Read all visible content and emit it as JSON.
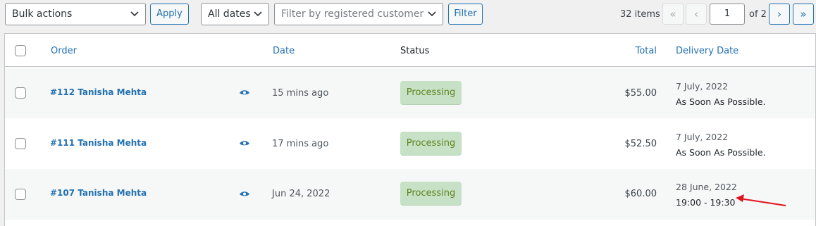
{
  "toolbar": {
    "bulk_actions": "Bulk actions",
    "apply": "Apply",
    "dates": "All dates",
    "customer_placeholder": "Filter by registered customer",
    "filter": "Filter",
    "items_count": "32 items",
    "first_page": "«",
    "prev_page": "‹",
    "current_page": "1",
    "of_total": "of 2",
    "next_page": "›",
    "last_page": "»"
  },
  "table": {
    "headers": {
      "order": "Order",
      "date": "Date",
      "status": "Status",
      "total": "Total",
      "delivery_date": "Delivery Date"
    },
    "rows": [
      {
        "order": "#112 Tanisha Mehta",
        "date": "15 mins ago",
        "status": "Processing",
        "total": "$55.00",
        "delivery_date": "7 July, 2022",
        "delivery_time": "As Soon As Possible."
      },
      {
        "order": "#111 Tanisha Mehta",
        "date": "17 mins ago",
        "status": "Processing",
        "total": "$52.50",
        "delivery_date": "7 July, 2022",
        "delivery_time": "As Soon As Possible."
      },
      {
        "order": "#107 Tanisha Mehta",
        "date": "Jun 24, 2022",
        "status": "Processing",
        "total": "$60.00",
        "delivery_date": "28 June, 2022",
        "delivery_time": "19:00 - 19:30"
      }
    ]
  },
  "colors": {
    "accent": "#2271b1",
    "status_bg": "#c6e1c6",
    "status_text": "#5b841b",
    "annotation_arrow": "#e0141e"
  }
}
